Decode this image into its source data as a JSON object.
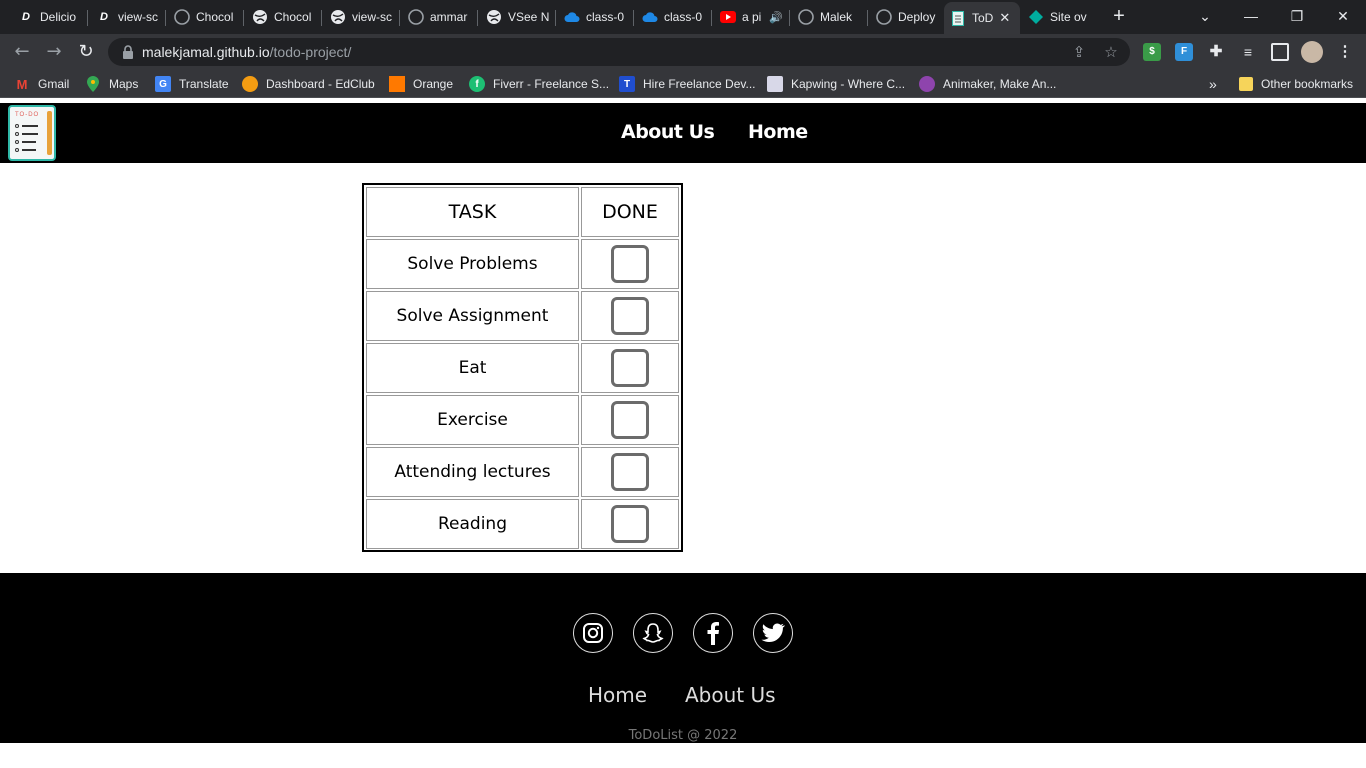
{
  "browser": {
    "tabs": [
      {
        "title": "Delicio",
        "icon": "d-icon"
      },
      {
        "title": "view-sc",
        "icon": "d-icon"
      },
      {
        "title": "Chocol",
        "icon": "github-icon"
      },
      {
        "title": "Chocol",
        "icon": "globe-icon"
      },
      {
        "title": "view-sc",
        "icon": "globe-icon"
      },
      {
        "title": "ammar",
        "icon": "github-icon"
      },
      {
        "title": "VSee N",
        "icon": "globe-icon"
      },
      {
        "title": "class-0",
        "icon": "cloud-icon"
      },
      {
        "title": "class-0",
        "icon": "cloud-icon"
      },
      {
        "title": "a pi",
        "icon": "youtube-icon"
      },
      {
        "title": "Malek",
        "icon": "github-icon"
      },
      {
        "title": "Deploy",
        "icon": "github-icon"
      },
      {
        "title": "ToD",
        "icon": "page-icon"
      },
      {
        "title": "Site ov",
        "icon": "diamond-icon"
      }
    ],
    "url_host": "malekjamal.github.io",
    "url_path": "/todo-project/",
    "extension_f": "F",
    "extension_dollar": "$",
    "bookmarks": [
      {
        "label": "Gmail",
        "icon": "gmail-icon"
      },
      {
        "label": "Maps",
        "icon": "maps-icon"
      },
      {
        "label": "Translate",
        "icon": "translate-icon"
      },
      {
        "label": "Dashboard - EdClub",
        "icon": "edclub-icon"
      },
      {
        "label": "Orange",
        "icon": "orange-icon"
      },
      {
        "label": "Fiverr - Freelance S...",
        "icon": "fiverr-icon"
      },
      {
        "label": "Hire Freelance Dev...",
        "icon": "toptal-icon"
      },
      {
        "label": "Kapwing - Where C...",
        "icon": "kapwing-icon"
      },
      {
        "label": "Animaker, Make An...",
        "icon": "animaker-icon"
      }
    ],
    "bookmarks_overflow": "»",
    "other_bookmarks": "Other bookmarks"
  },
  "header": {
    "nav": [
      "About Us",
      "Home"
    ]
  },
  "todo": {
    "columns": [
      "TASK",
      "DONE"
    ],
    "rows": [
      {
        "task": "Solve Problems",
        "done": false
      },
      {
        "task": "Solve Assignment",
        "done": false
      },
      {
        "task": "Eat",
        "done": false
      },
      {
        "task": "Exercise",
        "done": false
      },
      {
        "task": "Attending lectures",
        "done": false
      },
      {
        "task": "Reading",
        "done": false
      }
    ]
  },
  "footer": {
    "social": [
      "instagram-icon",
      "snapchat-icon",
      "facebook-icon",
      "twitter-icon"
    ],
    "links": [
      "Home",
      "About Us"
    ],
    "copyright": "ToDoList @ 2022"
  },
  "colors": {
    "chrome_dark": "#202124",
    "chrome_toolbar": "#35363a",
    "site_black": "#000000",
    "logo_accent": "#2fb8a8"
  }
}
